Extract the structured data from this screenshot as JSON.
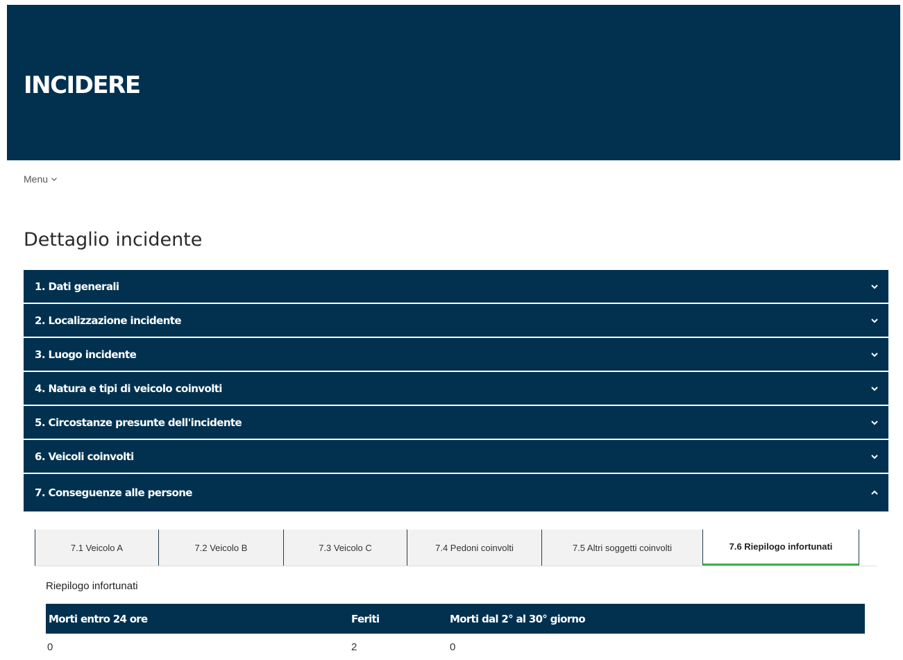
{
  "header": {
    "title": "INCIDERE"
  },
  "menu": {
    "label": "Menu"
  },
  "page": {
    "title": "Dettaglio incidente"
  },
  "accordion": [
    {
      "label": "1. Dati generali",
      "expanded": false
    },
    {
      "label": "2. Localizzazione incidente",
      "expanded": false
    },
    {
      "label": "3. Luogo incidente",
      "expanded": false
    },
    {
      "label": "4. Natura e tipi di veicolo coinvolti",
      "expanded": false
    },
    {
      "label": "5. Circostanze presunte dell'incidente",
      "expanded": false
    },
    {
      "label": "6. Veicoli coinvolti",
      "expanded": false
    },
    {
      "label": "7. Conseguenze alle persone",
      "expanded": true
    }
  ],
  "tabs": [
    {
      "label": "7.1 Veicolo A",
      "active": false
    },
    {
      "label": "7.2 Veicolo B",
      "active": false
    },
    {
      "label": "7.3 Veicolo C",
      "active": false
    },
    {
      "label": "7.4 Pedoni coinvolti",
      "active": false
    },
    {
      "label": "7.5 Altri soggetti coinvolti",
      "active": false
    },
    {
      "label": "7.6 Riepilogo infortunati",
      "active": true
    }
  ],
  "summary": {
    "caption": "Riepilogo infortunati",
    "columns": [
      "Morti entro 24 ore",
      "Feriti",
      "Morti dal 2° al 30° giorno"
    ],
    "rows": [
      [
        "0",
        "2",
        "0"
      ]
    ]
  },
  "colors": {
    "primary": "#023150",
    "active_tab_accent": "#3db04e"
  }
}
